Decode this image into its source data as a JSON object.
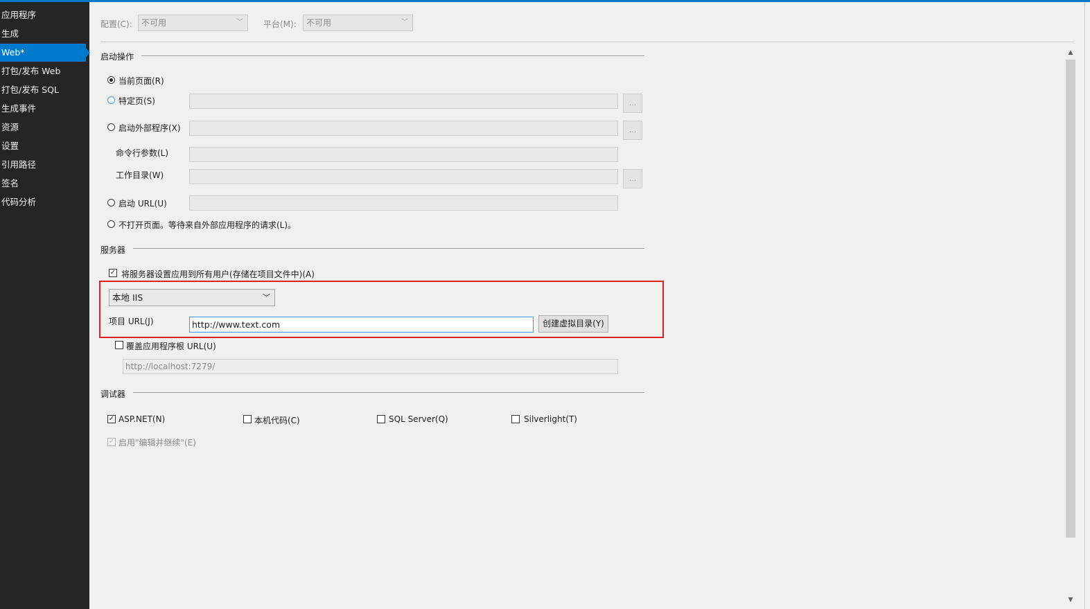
{
  "sidebar": {
    "items": [
      {
        "label": "应用程序"
      },
      {
        "label": "生成"
      },
      {
        "label": "Web*"
      },
      {
        "label": "打包/发布 Web"
      },
      {
        "label": "打包/发布 SQL"
      },
      {
        "label": "生成事件"
      },
      {
        "label": "资源"
      },
      {
        "label": "设置"
      },
      {
        "label": "引用路径"
      },
      {
        "label": "签名"
      },
      {
        "label": "代码分析"
      }
    ]
  },
  "toolbar": {
    "config_label": "配置(C):",
    "config_value": "不可用",
    "platform_label": "平台(M):",
    "platform_value": "不可用"
  },
  "start_action": {
    "title": "启动操作",
    "current_page": "当前页面(R)",
    "specific_page": "特定页(S)",
    "external_program": "启动外部程序(X)",
    "cmd_args": "命令行参数(L)",
    "work_dir": "工作目录(W)",
    "start_url": "启动 URL(U)",
    "dont_open": "不打开页面。等待来自外部应用程序的请求(L)。",
    "browse": "..."
  },
  "server": {
    "title": "服务器",
    "apply_all": "将服务器设置应用到所有用户(存储在项目文件中)(A)",
    "server_type": "本地 IIS",
    "project_url_label": "项目 URL(J)",
    "project_url_value": "http://www.text.com",
    "create_vdir": "创建虚拟目录(Y)",
    "override_root": "覆盖应用程序根 URL(U)",
    "root_url": "http://localhost:7279/"
  },
  "debugger": {
    "title": "调试器",
    "aspnet": "ASP.NET(N)",
    "native": "本机代码(C)",
    "sql": "SQL Server(Q)",
    "silverlight": "Silverlight(T)",
    "edit_continue": "启用\"编辑并继续\"(E)"
  },
  "checks": {
    "mark": "✓"
  },
  "icons": {
    "dropdown": "﹀",
    "scroll_up": "▲",
    "scroll_down": "▼"
  },
  "colors": {
    "accent": "#007acc",
    "highlight_box": "#e02020",
    "sidebar_bg": "#252526"
  }
}
